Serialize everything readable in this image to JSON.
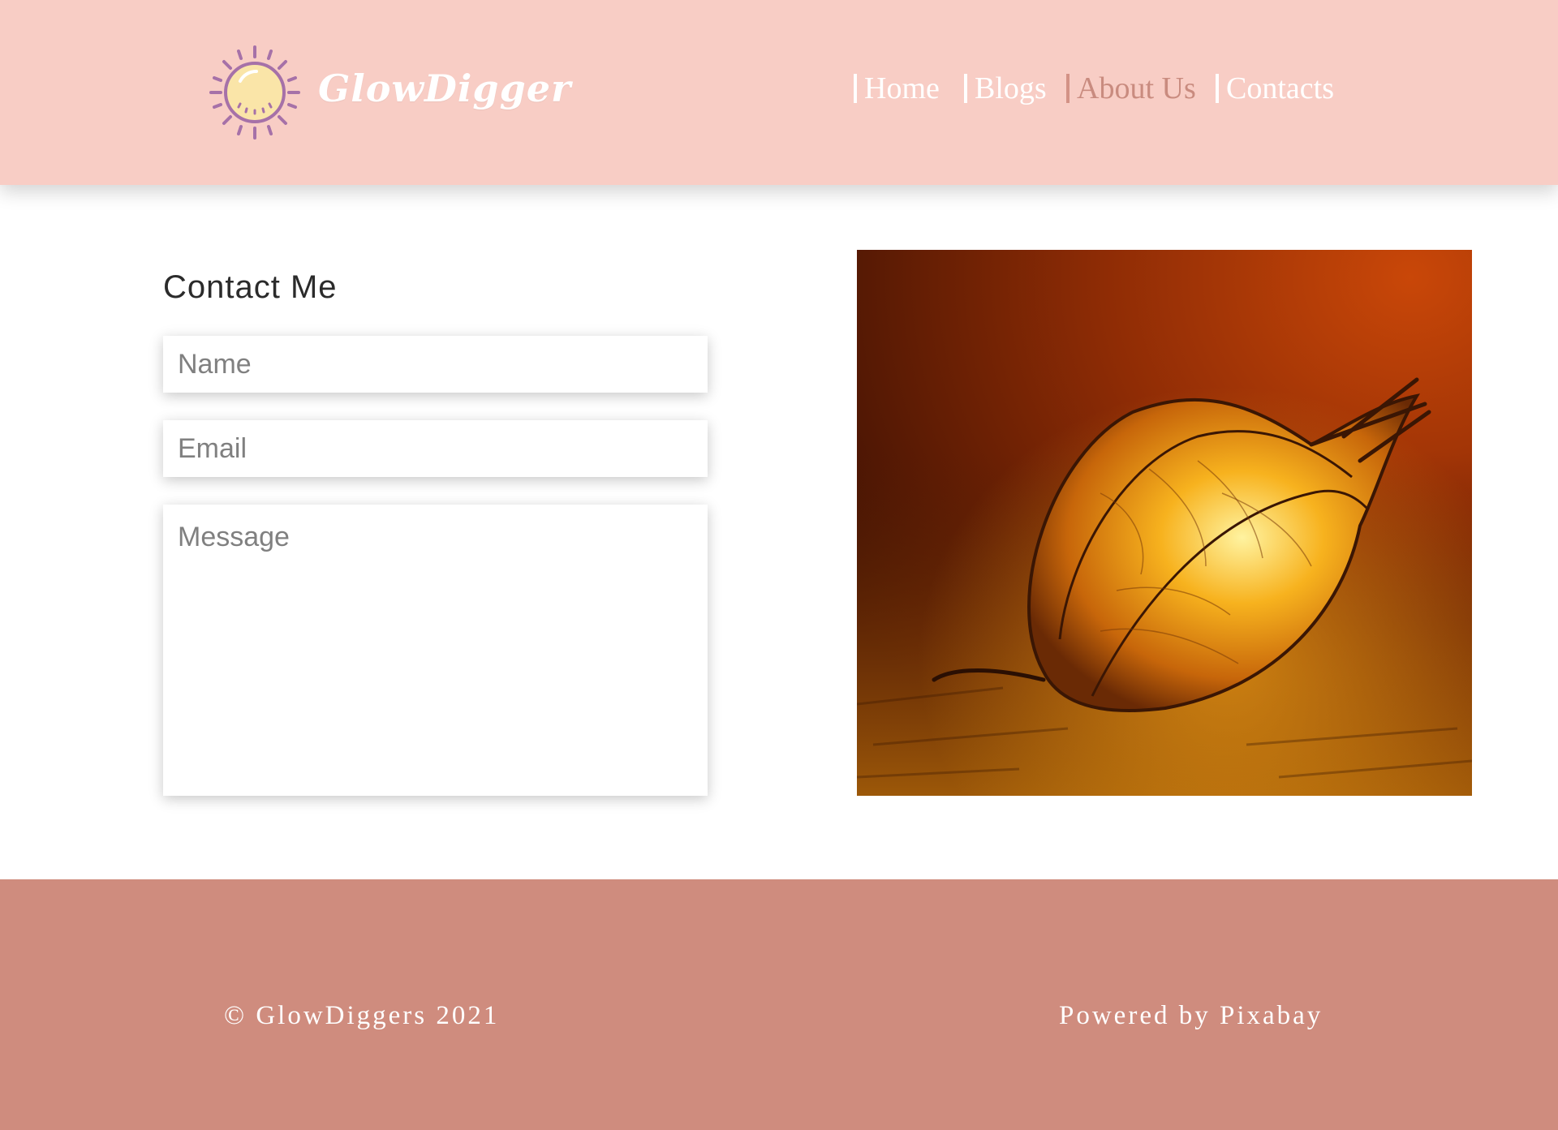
{
  "header": {
    "brand": "GlowDigger",
    "nav": [
      {
        "label": "Home"
      },
      {
        "label": "Blogs"
      },
      {
        "label": "About Us"
      },
      {
        "label": "Contacts"
      }
    ],
    "active_nav": "About Us"
  },
  "contact": {
    "title": "Contact Me",
    "name_placeholder": "Name",
    "email_placeholder": "Email",
    "message_placeholder": "Message"
  },
  "footer": {
    "copyright": "© GlowDiggers 2021",
    "powered_by": "Powered by Pixabay"
  },
  "colors": {
    "header_bg": "#f8cdc5",
    "footer_bg": "#cf8c7e",
    "active_nav": "#c98b7f",
    "logo_sun_fill": "#fae5a8",
    "logo_sun_stroke": "#a671a8"
  },
  "icons": {
    "logo": "sun-icon"
  }
}
